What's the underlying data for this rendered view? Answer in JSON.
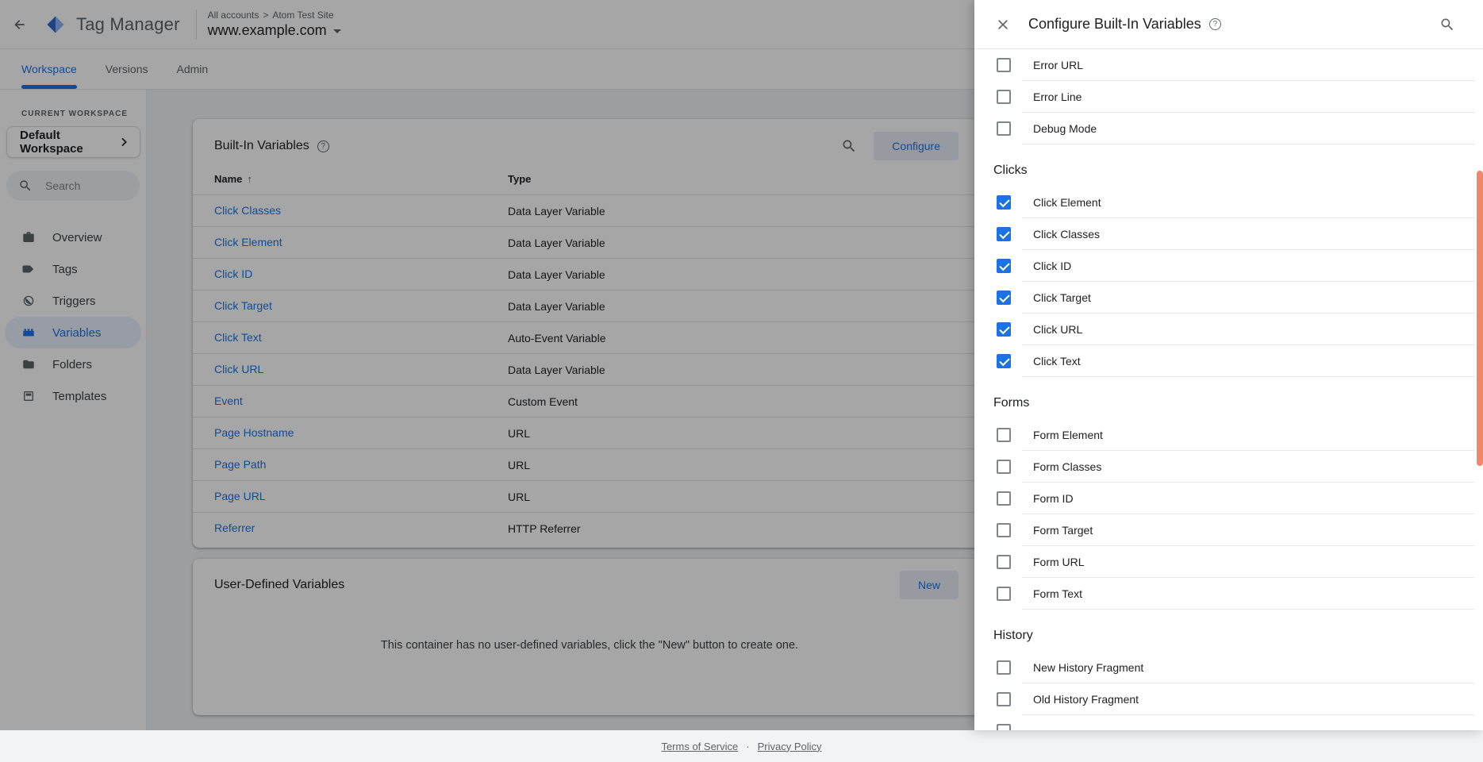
{
  "colors": {
    "accent": "#1a73e8",
    "scrollbar_thumb": "#f0876c",
    "checkbox_checked": "#1a73e8"
  },
  "header": {
    "app_title": "Tag Manager",
    "breadcrumb": {
      "parts": [
        "All accounts",
        "Atom Test Site"
      ],
      "separator": ">"
    },
    "container_name": "www.example.com"
  },
  "tabs": [
    {
      "label": "Workspace",
      "active": true
    },
    {
      "label": "Versions",
      "active": false
    },
    {
      "label": "Admin",
      "active": false
    }
  ],
  "sidebar": {
    "section_label": "CURRENT WORKSPACE",
    "workspace_name": "Default Workspace",
    "search_placeholder": "Search",
    "items": [
      {
        "label": "Overview",
        "icon": "overview-icon",
        "active": false
      },
      {
        "label": "Tags",
        "icon": "tag-icon",
        "active": false
      },
      {
        "label": "Triggers",
        "icon": "trigger-icon",
        "active": false
      },
      {
        "label": "Variables",
        "icon": "variables-icon",
        "active": true
      },
      {
        "label": "Folders",
        "icon": "folder-icon",
        "active": false
      },
      {
        "label": "Templates",
        "icon": "template-icon",
        "active": false
      }
    ]
  },
  "main": {
    "builtin": {
      "title": "Built-In Variables",
      "configure_label": "Configure",
      "columns": {
        "name": "Name",
        "type": "Type"
      },
      "sort": "ascending",
      "rows": [
        {
          "name": "Click Classes",
          "type": "Data Layer Variable"
        },
        {
          "name": "Click Element",
          "type": "Data Layer Variable"
        },
        {
          "name": "Click ID",
          "type": "Data Layer Variable"
        },
        {
          "name": "Click Target",
          "type": "Data Layer Variable"
        },
        {
          "name": "Click Text",
          "type": "Auto-Event Variable"
        },
        {
          "name": "Click URL",
          "type": "Data Layer Variable"
        },
        {
          "name": "Event",
          "type": "Custom Event"
        },
        {
          "name": "Page Hostname",
          "type": "URL"
        },
        {
          "name": "Page Path",
          "type": "URL"
        },
        {
          "name": "Page URL",
          "type": "URL"
        },
        {
          "name": "Referrer",
          "type": "HTTP Referrer"
        }
      ]
    },
    "user_defined": {
      "title": "User-Defined Variables",
      "new_label": "New",
      "empty_text": "This container has no user-defined variables, click the \"New\" button to create one."
    }
  },
  "footer": {
    "links": [
      "Terms of Service",
      "Privacy Policy"
    ],
    "separator": "·"
  },
  "panel": {
    "title": "Configure Built-In Variables",
    "groups": [
      {
        "heading": "",
        "items": [
          {
            "label": "Error URL",
            "checked": false
          },
          {
            "label": "Error Line",
            "checked": false
          },
          {
            "label": "Debug Mode",
            "checked": false
          }
        ]
      },
      {
        "heading": "Clicks",
        "items": [
          {
            "label": "Click Element",
            "checked": true
          },
          {
            "label": "Click Classes",
            "checked": true
          },
          {
            "label": "Click ID",
            "checked": true
          },
          {
            "label": "Click Target",
            "checked": true
          },
          {
            "label": "Click URL",
            "checked": true
          },
          {
            "label": "Click Text",
            "checked": true
          }
        ]
      },
      {
        "heading": "Forms",
        "items": [
          {
            "label": "Form Element",
            "checked": false
          },
          {
            "label": "Form Classes",
            "checked": false
          },
          {
            "label": "Form ID",
            "checked": false
          },
          {
            "label": "Form Target",
            "checked": false
          },
          {
            "label": "Form URL",
            "checked": false
          },
          {
            "label": "Form Text",
            "checked": false
          }
        ]
      },
      {
        "heading": "History",
        "items": [
          {
            "label": "New History Fragment",
            "checked": false
          },
          {
            "label": "Old History Fragment",
            "checked": false
          }
        ]
      }
    ]
  }
}
